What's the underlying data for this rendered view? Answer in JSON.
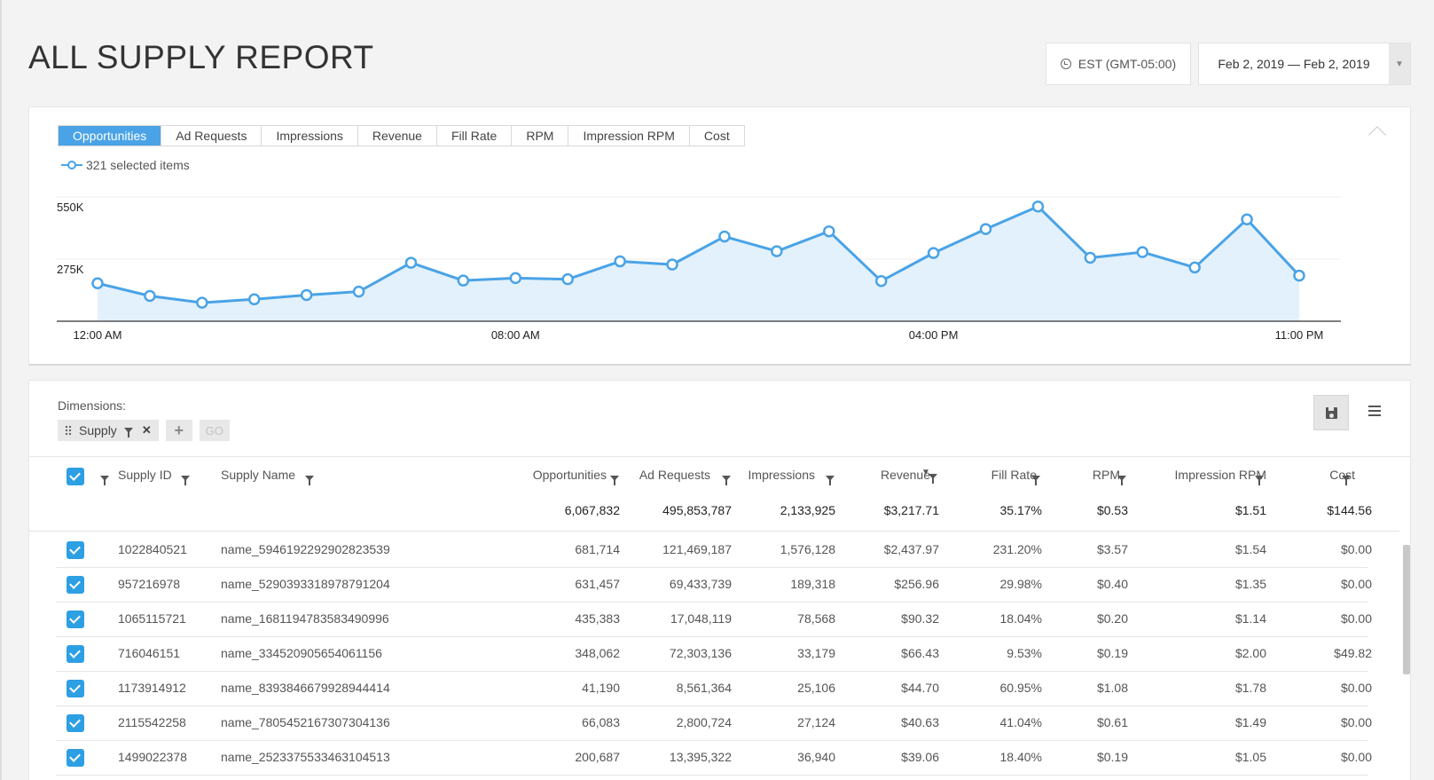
{
  "page": {
    "title": "ALL SUPPLY REPORT"
  },
  "header": {
    "timezone": "EST (GMT-05:00)",
    "date_range": "Feb 2, 2019 — Feb 2, 2019"
  },
  "chart_panel": {
    "tabs": [
      "Opportunities",
      "Ad Requests",
      "Impressions",
      "Revenue",
      "Fill Rate",
      "RPM",
      "Impression RPM",
      "Cost"
    ],
    "active_tab": "Opportunities",
    "legend_label": "321 selected items"
  },
  "chart_data": {
    "type": "area",
    "title": "",
    "xlabel": "",
    "ylabel": "",
    "y_tick_labels": [
      "550K",
      "275K"
    ],
    "y_ticks": [
      550000,
      275000
    ],
    "ylim": [
      0,
      550000
    ],
    "x_tick_labels": [
      "12:00 AM",
      "08:00 AM",
      "04:00 PM",
      "11:00 PM"
    ],
    "x_tick_hours": [
      0,
      8,
      16,
      23
    ],
    "grid": true,
    "series": [
      {
        "values": [
          168000,
          112000,
          82000,
          97000,
          116000,
          131000,
          259000,
          180000,
          191000,
          186000,
          265000,
          251000,
          375000,
          310000,
          398000,
          178000,
          302000,
          408000,
          508000,
          281000,
          306000,
          238000,
          451000,
          202000
        ]
      }
    ],
    "color": "#4aa3e6",
    "fill": "#e3f1fc"
  },
  "table_panel": {
    "dimensions_label": "Dimensions:",
    "chip_label": "Supply",
    "go_label": "GO",
    "columns": {
      "supply_id": "Supply ID",
      "supply_name": "Supply Name",
      "opportunities": "Opportunities",
      "ad_requests": "Ad Requests",
      "impressions": "Impressions",
      "revenue": "Revenue",
      "fill_rate": "Fill Rate",
      "rpm": "RPM",
      "impression_rpm": "Impression RPM",
      "cost": "Cost"
    },
    "totals": {
      "opportunities": "6,067,832",
      "ad_requests": "495,853,787",
      "impressions": "2,133,925",
      "revenue": "$3,217.71",
      "fill_rate": "35.17%",
      "rpm": "$0.53",
      "impression_rpm": "$1.51",
      "cost": "$144.56"
    },
    "rows": [
      {
        "supply_id": "1022840521",
        "supply_name": "name_5946192292902823539",
        "opportunities": "681,714",
        "ad_requests": "121,469,187",
        "impressions": "1,576,128",
        "revenue": "$2,437.97",
        "fill_rate": "231.20%",
        "rpm": "$3.57",
        "impression_rpm": "$1.54",
        "cost": "$0.00"
      },
      {
        "supply_id": "957216978",
        "supply_name": "name_5290393318978791204",
        "opportunities": "631,457",
        "ad_requests": "69,433,739",
        "impressions": "189,318",
        "revenue": "$256.96",
        "fill_rate": "29.98%",
        "rpm": "$0.40",
        "impression_rpm": "$1.35",
        "cost": "$0.00"
      },
      {
        "supply_id": "1065115721",
        "supply_name": "name_1681194783583490996",
        "opportunities": "435,383",
        "ad_requests": "17,048,119",
        "impressions": "78,568",
        "revenue": "$90.32",
        "fill_rate": "18.04%",
        "rpm": "$0.20",
        "impression_rpm": "$1.14",
        "cost": "$0.00"
      },
      {
        "supply_id": "716046151",
        "supply_name": "name_334520905654061156",
        "opportunities": "348,062",
        "ad_requests": "72,303,136",
        "impressions": "33,179",
        "revenue": "$66.43",
        "fill_rate": "9.53%",
        "rpm": "$0.19",
        "impression_rpm": "$2.00",
        "cost": "$49.82"
      },
      {
        "supply_id": "1173914912",
        "supply_name": "name_8393846679928944414",
        "opportunities": "41,190",
        "ad_requests": "8,561,364",
        "impressions": "25,106",
        "revenue": "$44.70",
        "fill_rate": "60.95%",
        "rpm": "$1.08",
        "impression_rpm": "$1.78",
        "cost": "$0.00"
      },
      {
        "supply_id": "2115542258",
        "supply_name": "name_7805452167307304136",
        "opportunities": "66,083",
        "ad_requests": "2,800,724",
        "impressions": "27,124",
        "revenue": "$40.63",
        "fill_rate": "41.04%",
        "rpm": "$0.61",
        "impression_rpm": "$1.49",
        "cost": "$0.00"
      },
      {
        "supply_id": "1499022378",
        "supply_name": "name_2523375533463104513",
        "opportunities": "200,687",
        "ad_requests": "13,395,322",
        "impressions": "36,940",
        "revenue": "$39.06",
        "fill_rate": "18.40%",
        "rpm": "$0.19",
        "impression_rpm": "$1.05",
        "cost": "$0.00"
      }
    ]
  }
}
